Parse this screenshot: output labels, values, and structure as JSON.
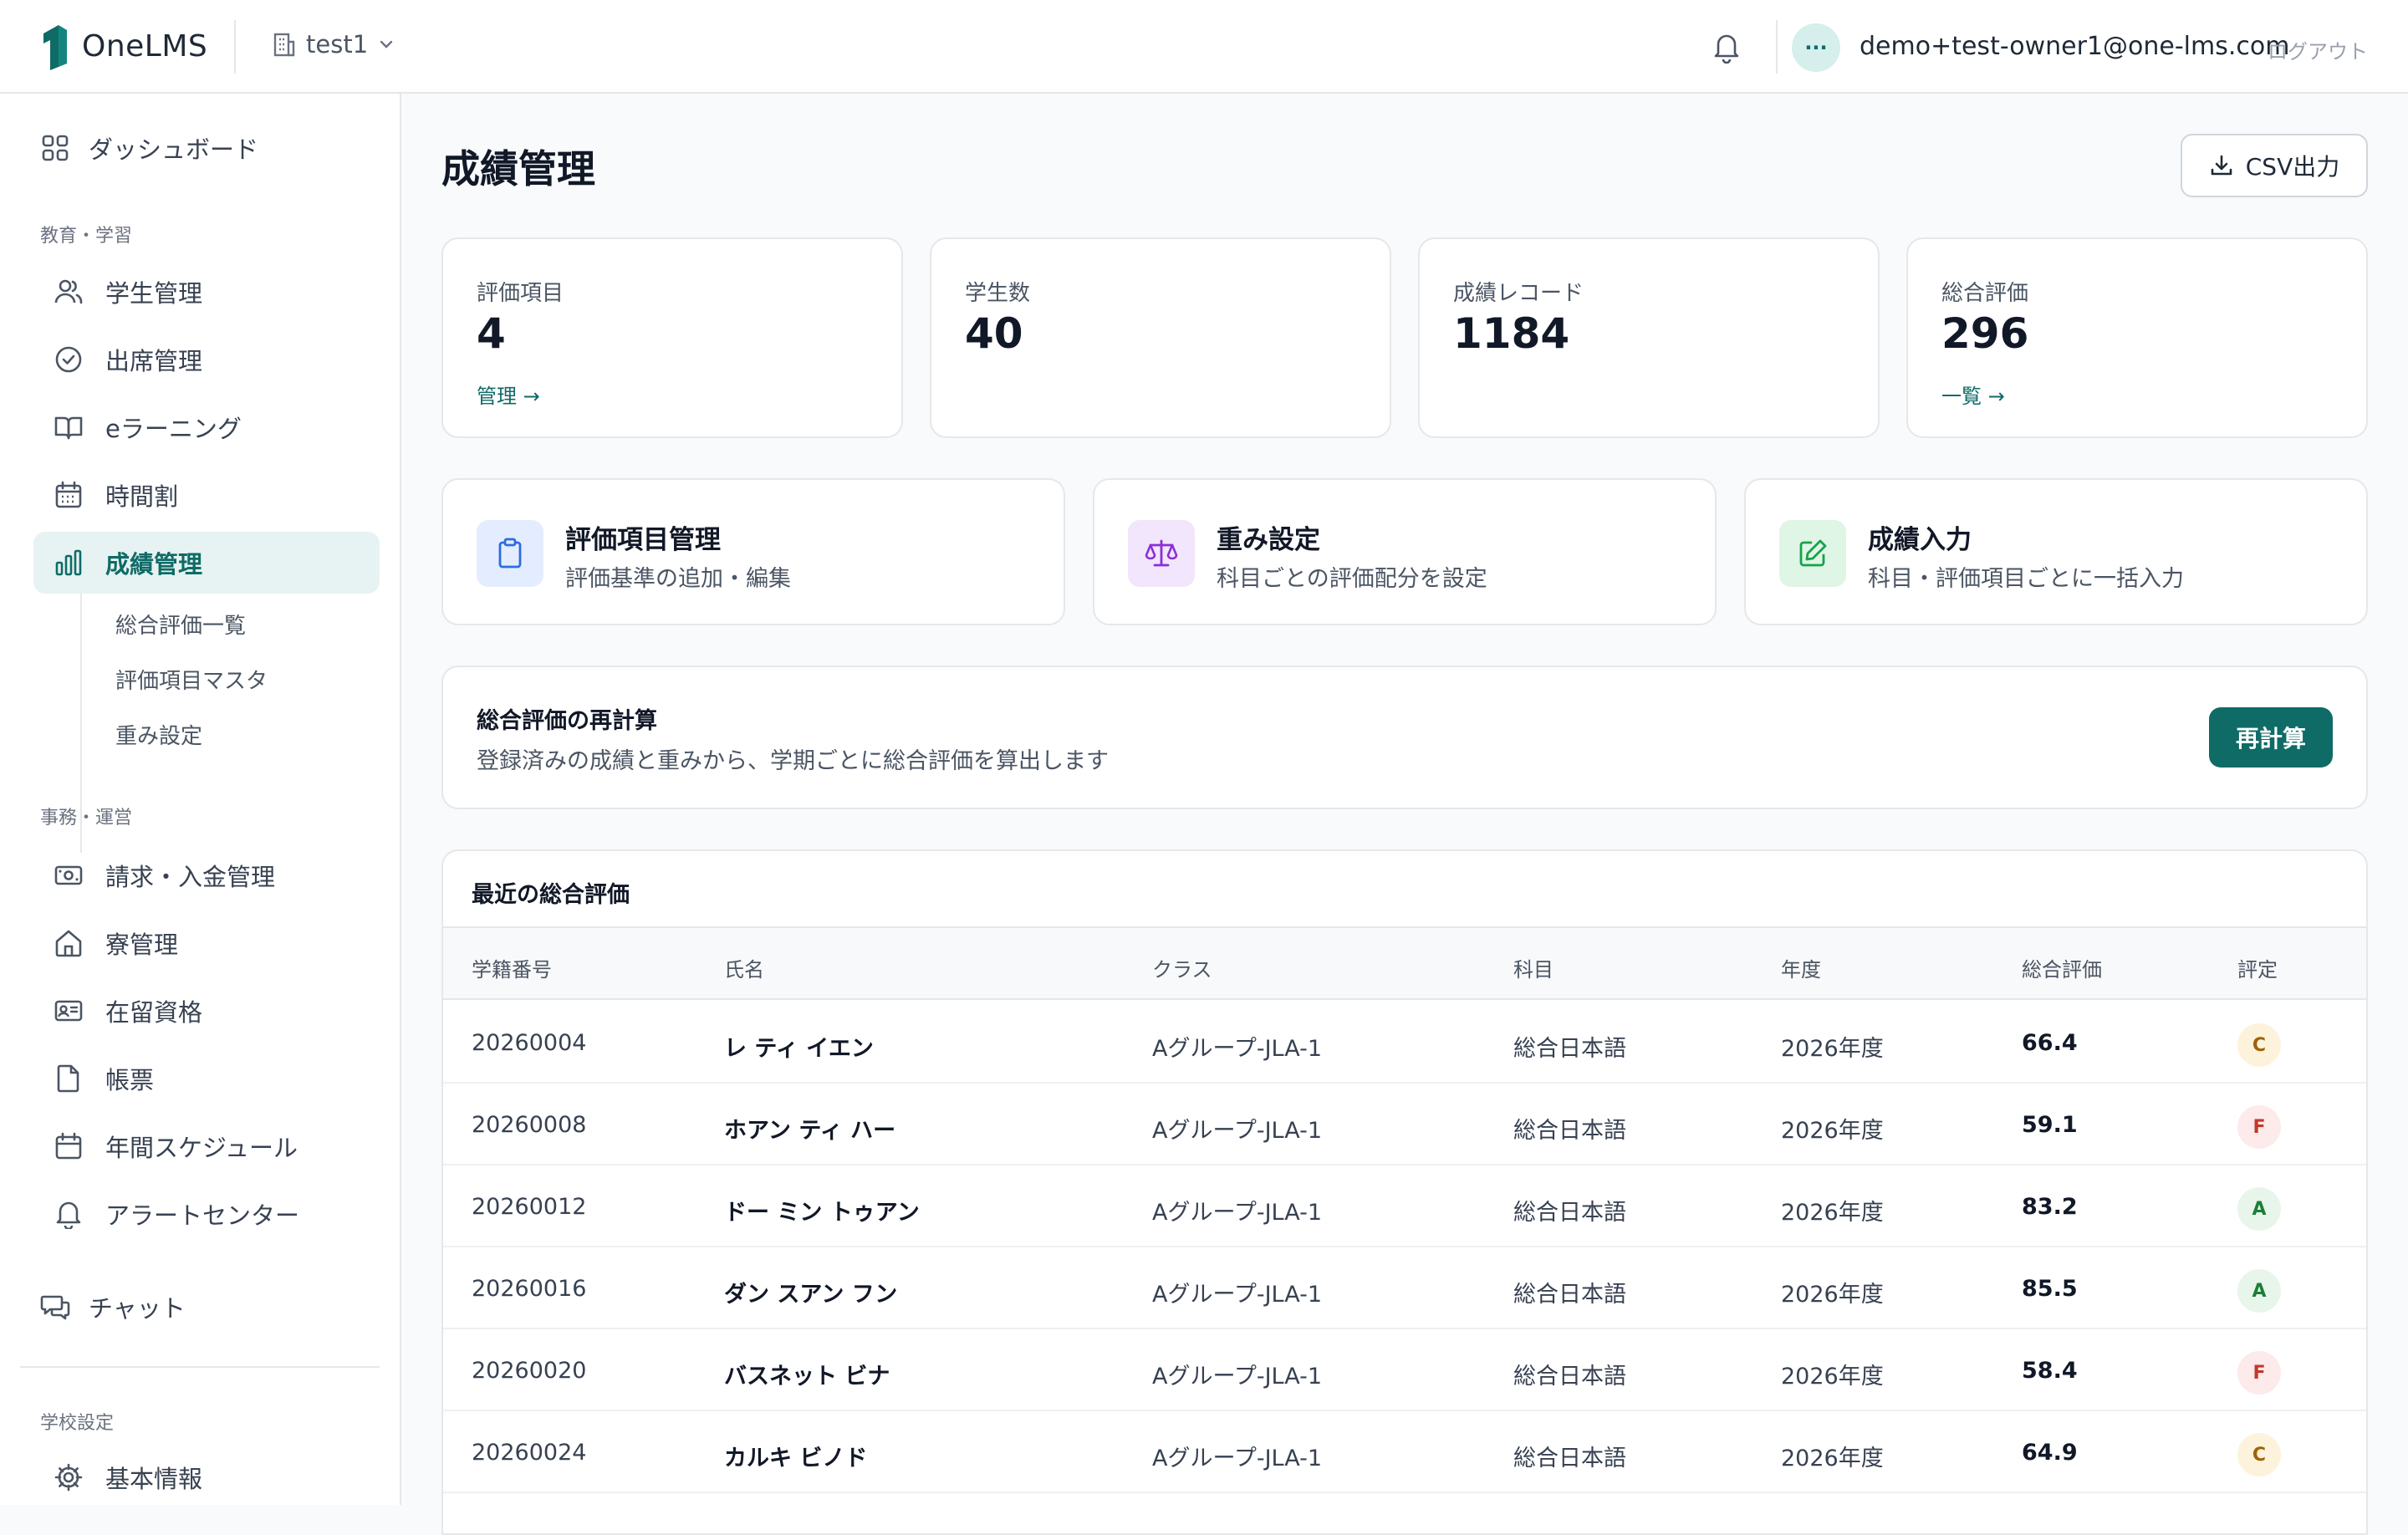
{
  "header": {
    "brand": "OneLMS",
    "org": "test1",
    "user_initials": "···",
    "user_email": "demo+test-owner1@one-lms.com",
    "logout": "ログアウト"
  },
  "sidebar": {
    "dashboard": "ダッシュボード",
    "sections": {
      "education": "教育・学習",
      "office": "事務・運営",
      "school": "学校設定"
    },
    "education_items": [
      "学生管理",
      "出席管理",
      "eラーニング",
      "時間割",
      "成績管理"
    ],
    "grade_sub_items": [
      "総合評価一覧",
      "評価項目マスタ",
      "重み設定"
    ],
    "office_items": [
      "請求・入金管理",
      "寮管理",
      "在留資格",
      "帳票",
      "年間スケジュール",
      "アラートセンター"
    ],
    "chat": "チャット",
    "school_items": [
      "基本情報"
    ]
  },
  "main": {
    "title": "成績管理",
    "csv_button": "CSV出力",
    "stats": [
      {
        "label": "評価項目",
        "value": "4",
        "link": "管理 →"
      },
      {
        "label": "学生数",
        "value": "40",
        "link": ""
      },
      {
        "label": "成績レコード",
        "value": "1184",
        "link": ""
      },
      {
        "label": "総合評価",
        "value": "296",
        "link": "一覧 →"
      }
    ],
    "actions": [
      {
        "title": "評価項目管理",
        "subtitle": "評価基準の追加・編集"
      },
      {
        "title": "重み設定",
        "subtitle": "科目ごとの評価配分を設定"
      },
      {
        "title": "成績入力",
        "subtitle": "科目・評価項目ごとに一括入力"
      }
    ],
    "recalc": {
      "title": "総合評価の再計算",
      "subtitle": "登録済みの成績と重みから、学期ごとに総合評価を算出します",
      "button": "再計算"
    },
    "table": {
      "title": "最近の総合評価",
      "columns": [
        "学籍番号",
        "氏名",
        "クラス",
        "科目",
        "年度",
        "総合評価",
        "評定"
      ],
      "rows": [
        {
          "id": "20260004",
          "name": "レ ティ イエン",
          "class": "Aグループ-JLA-1",
          "subject": "総合日本語",
          "year": "2026年度",
          "score": "66.4",
          "grade": "C"
        },
        {
          "id": "20260008",
          "name": "ホアン ティ ハー",
          "class": "Aグループ-JLA-1",
          "subject": "総合日本語",
          "year": "2026年度",
          "score": "59.1",
          "grade": "F"
        },
        {
          "id": "20260012",
          "name": "ドー ミン トゥアン",
          "class": "Aグループ-JLA-1",
          "subject": "総合日本語",
          "year": "2026年度",
          "score": "83.2",
          "grade": "A"
        },
        {
          "id": "20260016",
          "name": "ダン スアン フン",
          "class": "Aグループ-JLA-1",
          "subject": "総合日本語",
          "year": "2026年度",
          "score": "85.5",
          "grade": "A"
        },
        {
          "id": "20260020",
          "name": "バスネット ビナ",
          "class": "Aグループ-JLA-1",
          "subject": "総合日本語",
          "year": "2026年度",
          "score": "58.4",
          "grade": "F"
        },
        {
          "id": "20260024",
          "name": "カルキ ビノド",
          "class": "Aグループ-JLA-1",
          "subject": "総合日本語",
          "year": "2026年度",
          "score": "64.9",
          "grade": "C"
        }
      ]
    }
  },
  "colors": {
    "accent": "#0f6b66",
    "accent_light": "#e6f3f2",
    "grade_A": "#e8f5ea",
    "grade_C": "#fdf3dc",
    "grade_F": "#fdeaea"
  }
}
